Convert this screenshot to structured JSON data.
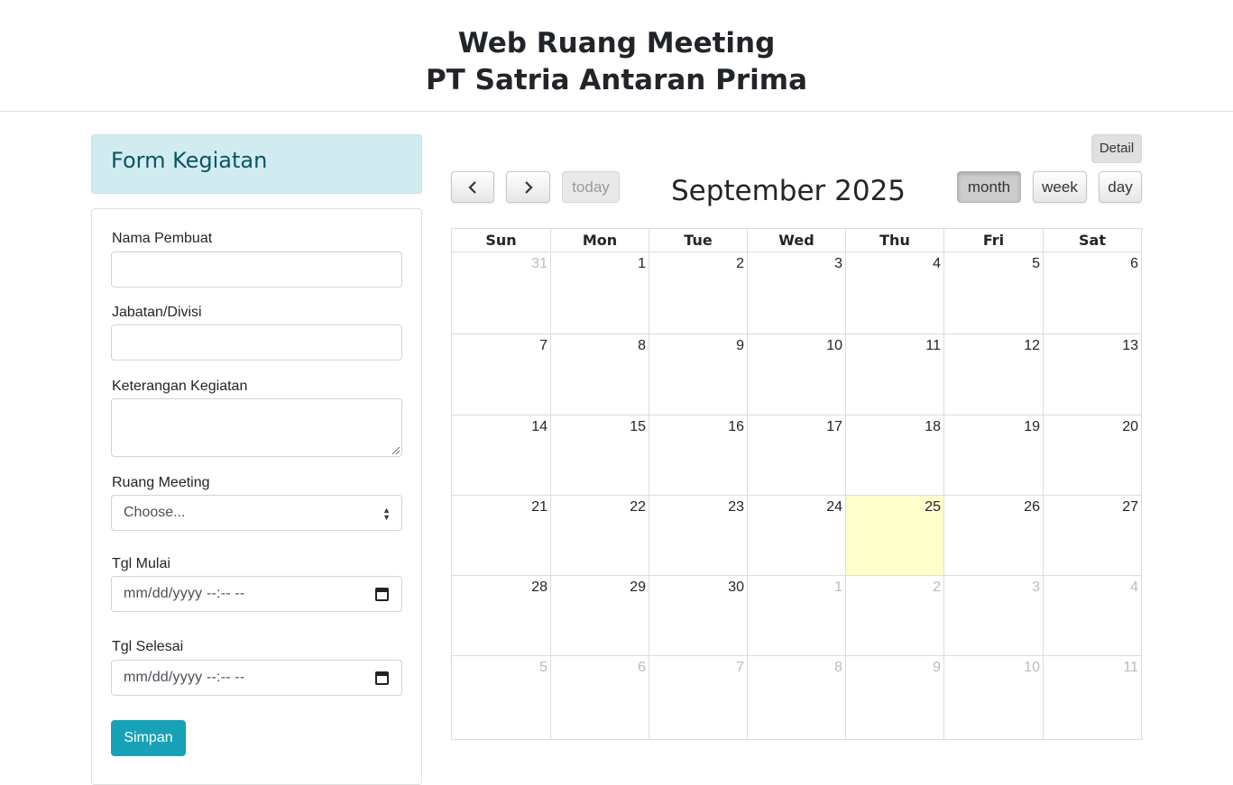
{
  "header": {
    "title_line1": "Web Ruang Meeting",
    "title_line2": "PT Satria Antaran Prima"
  },
  "form": {
    "title": "Form Kegiatan",
    "fields": {
      "nama_label": "Nama Pembuat",
      "nama_value": "",
      "jabatan_label": "Jabatan/Divisi",
      "jabatan_value": "",
      "keterangan_label": "Keterangan Kegiatan",
      "keterangan_value": "",
      "ruang_label": "Ruang Meeting",
      "ruang_selected": "Choose...",
      "mulai_label": "Tgl Mulai",
      "mulai_placeholder": "mm/dd/yyyy --:-- --",
      "selesai_label": "Tgl Selesai",
      "selesai_placeholder": "mm/dd/yyyy --:-- --"
    },
    "submit_label": "Simpan"
  },
  "calendar": {
    "detail_label": "Detail",
    "prev_icon": "chevron-left-icon",
    "next_icon": "chevron-right-icon",
    "today_label": "today",
    "title": "September 2025",
    "views": {
      "month": "month",
      "week": "week",
      "day": "day"
    },
    "active_view": "month",
    "day_headers": [
      "Sun",
      "Mon",
      "Tue",
      "Wed",
      "Thu",
      "Fri",
      "Sat"
    ],
    "weeks": [
      [
        {
          "d": "31",
          "o": true
        },
        {
          "d": "1"
        },
        {
          "d": "2"
        },
        {
          "d": "3"
        },
        {
          "d": "4"
        },
        {
          "d": "5"
        },
        {
          "d": "6"
        }
      ],
      [
        {
          "d": "7"
        },
        {
          "d": "8"
        },
        {
          "d": "9"
        },
        {
          "d": "10"
        },
        {
          "d": "11"
        },
        {
          "d": "12"
        },
        {
          "d": "13"
        }
      ],
      [
        {
          "d": "14"
        },
        {
          "d": "15"
        },
        {
          "d": "16"
        },
        {
          "d": "17"
        },
        {
          "d": "18"
        },
        {
          "d": "19"
        },
        {
          "d": "20"
        }
      ],
      [
        {
          "d": "21"
        },
        {
          "d": "22"
        },
        {
          "d": "23"
        },
        {
          "d": "24"
        },
        {
          "d": "25",
          "t": true
        },
        {
          "d": "26"
        },
        {
          "d": "27"
        }
      ],
      [
        {
          "d": "28"
        },
        {
          "d": "29"
        },
        {
          "d": "30"
        },
        {
          "d": "1",
          "o": true
        },
        {
          "d": "2",
          "o": true
        },
        {
          "d": "3",
          "o": true
        },
        {
          "d": "4",
          "o": true
        }
      ],
      [
        {
          "d": "5",
          "o": true
        },
        {
          "d": "6",
          "o": true
        },
        {
          "d": "7",
          "o": true
        },
        {
          "d": "8",
          "o": true
        },
        {
          "d": "9",
          "o": true
        },
        {
          "d": "10",
          "o": true
        },
        {
          "d": "11",
          "o": true
        }
      ]
    ],
    "colors": {
      "today_bg": "#ffffcc",
      "other_month_text": "#bbbbbb",
      "grid_line": "#dddddd"
    }
  }
}
